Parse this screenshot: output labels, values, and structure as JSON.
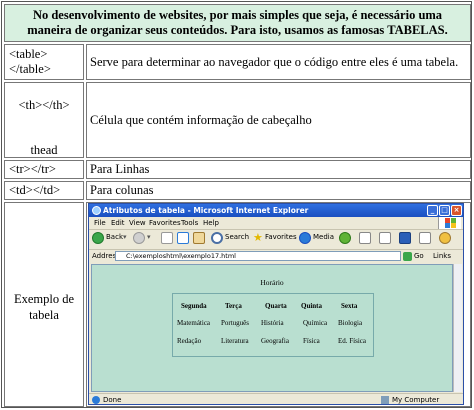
{
  "intro": {
    "line1": "No desenvolvimento de websites, por mais simples que seja, é necessário uma",
    "line2": "maneira de organizar seus conteúdos. Para isto, usamos as famosas TABELAS."
  },
  "rows": [
    {
      "tag_line1": "<table>",
      "tag_line2": "</table>",
      "desc": "Serve para determinar ao navegador que o código entre eles é uma tabela."
    },
    {
      "tag_line1": "<th></th>",
      "tag_line2": "thead",
      "desc": "Célula que contém informação de cabeçalho"
    },
    {
      "tag": "<tr></tr>",
      "desc": "Para Linhas"
    },
    {
      "tag": "<td></td>",
      "desc": "Para colunas"
    }
  ],
  "example": {
    "label_line1": "Exemplo de",
    "label_line2": "tabela"
  },
  "browser": {
    "title": "Atributos de tabela - Microsoft Internet Explorer",
    "menu": [
      "File",
      "Edit",
      "View",
      "Favorites",
      "Tools",
      "Help"
    ],
    "toolbar": {
      "back": "Back",
      "search": "Search",
      "favorites": "Favorites",
      "media": "Media"
    },
    "address_label": "Address",
    "address_value": "C:\\exemploshtml\\exemplo17.html",
    "go": "Go",
    "links": "Links",
    "status_left": "Done",
    "status_right": "My Computer",
    "page": {
      "caption": "Horário",
      "headers": [
        "Segunda",
        "Terça",
        "Quarta",
        "Quinta",
        "Sexta"
      ],
      "row1": [
        "Matemática",
        "Português",
        "História",
        "Química",
        "Biologia"
      ],
      "row2": [
        "Redação",
        "Literatura",
        "Geografia",
        "Física",
        "Ed. Física"
      ]
    }
  },
  "colors": {
    "header_bg": "#d8f0e0",
    "page_bg": "#b9dfd0",
    "titlebar": "#1a4fc0"
  }
}
